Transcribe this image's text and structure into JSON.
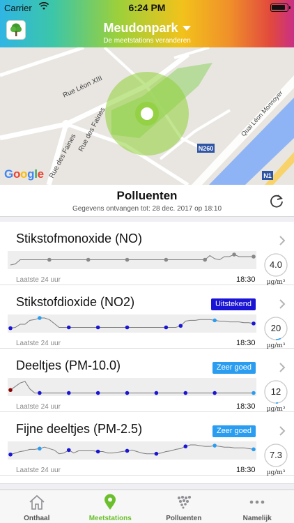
{
  "status_bar": {
    "carrier": "Carrier",
    "time": "6:24 PM"
  },
  "header": {
    "title": "Meudonpark",
    "subtitle": "De meetstations veranderen"
  },
  "map": {
    "labels": [
      "Rue Léon XIII",
      "Rue des Faines",
      "Rue des Faines",
      "Quai Léon Monnoyer",
      "N260",
      "N1"
    ],
    "attribution": "Google"
  },
  "section": {
    "title": "Polluenten",
    "received": "Gegevens ontvangen tot: 28 dec. 2017 op 18:10"
  },
  "pollutants": [
    {
      "name": "Stikstofmonoxide (NO)",
      "badge": "",
      "badge_color": "",
      "period": "Laatste 24 uur",
      "time": "18:30",
      "value": "4.0",
      "unit": "µg/m³",
      "gauge_fraction": 0.0,
      "series": [
        2,
        3,
        7,
        7,
        7,
        7,
        7,
        7,
        7,
        7,
        7,
        7,
        7,
        7,
        7,
        7,
        7,
        7,
        7,
        7,
        7,
        7,
        7,
        7,
        7,
        7,
        7,
        7,
        7,
        7,
        7,
        7,
        7,
        7,
        7,
        7,
        7,
        7,
        7,
        7,
        7,
        11,
        8,
        7,
        10,
        10,
        12,
        10,
        10,
        10,
        10
      ],
      "point_color": "#888888",
      "point_indices": [
        8,
        16,
        24,
        32,
        40,
        46,
        50
      ]
    },
    {
      "name": "Stikstofdioxide (NO2)",
      "badge": "Uitstekend",
      "badge_color": "#1a14d4",
      "period": "Laatste 24 uur",
      "time": "18:30",
      "value": "20",
      "unit": "µg/m³",
      "gauge_fraction": 0.07,
      "series": [
        3,
        4,
        8,
        8,
        13,
        14,
        16,
        16,
        14,
        9,
        4,
        4,
        4,
        4,
        4,
        4,
        4,
        4,
        4,
        4,
        4,
        4,
        4,
        4,
        4,
        4,
        4,
        4,
        4,
        4,
        4,
        4,
        4,
        4,
        4,
        6,
        12,
        13,
        13,
        14,
        14,
        14,
        13,
        12,
        12,
        11,
        11,
        11,
        10,
        10,
        9
      ],
      "point_colors": [
        [
          "#1a14d4"
        ],
        [
          "#2a9df0"
        ]
      ],
      "points": [
        [
          0,
          "#1a14d4"
        ],
        [
          6,
          "#2a9df0"
        ],
        [
          12,
          "#1a14d4"
        ],
        [
          18,
          "#1a14d4"
        ],
        [
          24,
          "#1a14d4"
        ],
        [
          32,
          "#1a14d4"
        ],
        [
          35,
          "#1a14d4"
        ],
        [
          42,
          "#2a9df0"
        ],
        [
          50,
          "#1a14d4"
        ]
      ]
    },
    {
      "name": "Deeltjes (PM-10.0)",
      "badge": "Zeer goed",
      "badge_color": "#2a9df0",
      "period": "Laatste 24 uur",
      "time": "18:30",
      "value": "12",
      "unit": "µg/m³",
      "gauge_fraction": 0.03,
      "series": [
        8,
        15,
        22,
        25,
        10,
        2,
        2,
        2,
        2,
        2,
        2,
        2,
        2,
        2,
        2,
        2,
        2,
        2,
        2,
        2,
        2,
        2,
        2,
        2,
        2,
        2,
        2,
        2,
        2,
        2,
        2,
        2,
        2,
        2,
        2,
        2,
        2,
        2,
        2,
        2,
        2,
        2,
        2,
        2,
        2,
        2,
        2,
        2,
        2,
        2,
        2
      ],
      "points": [
        [
          0,
          "#8b0000"
        ],
        [
          6,
          "#1a14d4"
        ],
        [
          12,
          "#1a14d4"
        ],
        [
          18,
          "#1a14d4"
        ],
        [
          24,
          "#1a14d4"
        ],
        [
          30,
          "#1a14d4"
        ],
        [
          36,
          "#1a14d4"
        ],
        [
          42,
          "#1a14d4"
        ],
        [
          50,
          "#2a9df0"
        ]
      ]
    },
    {
      "name": "Fijne deeltjes (PM-2.5)",
      "badge": "Zeer goed",
      "badge_color": "#2a9df0",
      "period": "Laatste 24 uur",
      "time": "18:30",
      "value": "7.3",
      "unit": "µg/m³",
      "gauge_fraction": 0.0,
      "series": [
        4,
        6,
        8,
        9,
        11,
        11,
        12,
        14,
        12,
        10,
        5,
        6,
        10,
        6,
        9,
        9,
        9,
        9,
        8,
        8,
        6,
        6,
        7,
        8,
        9,
        10,
        8,
        6,
        5,
        5,
        5,
        6,
        8,
        9,
        11,
        12,
        15,
        17,
        17,
        16,
        15,
        15,
        16,
        15,
        14,
        14,
        13,
        13,
        13,
        12,
        11
      ],
      "points": [
        [
          0,
          "#1a14d4"
        ],
        [
          6,
          "#2a9df0"
        ],
        [
          12,
          "#1a14d4"
        ],
        [
          18,
          "#1a14d4"
        ],
        [
          24,
          "#1a14d4"
        ],
        [
          30,
          "#1a14d4"
        ],
        [
          36,
          "#1a14d4"
        ],
        [
          42,
          "#2a9df0"
        ],
        [
          50,
          "#2a9df0"
        ]
      ]
    }
  ],
  "tabs": [
    {
      "label": "Onthaal",
      "icon": "home-icon",
      "active": false
    },
    {
      "label": "Meetstations",
      "icon": "location-pin-icon",
      "active": true
    },
    {
      "label": "Polluenten",
      "icon": "particles-icon",
      "active": false
    },
    {
      "label": "Namelijk",
      "icon": "more-icon",
      "active": false
    }
  ],
  "colors": {
    "accent": "#6bbf2c",
    "excellent": "#1a14d4",
    "very_good": "#2a9df0"
  }
}
